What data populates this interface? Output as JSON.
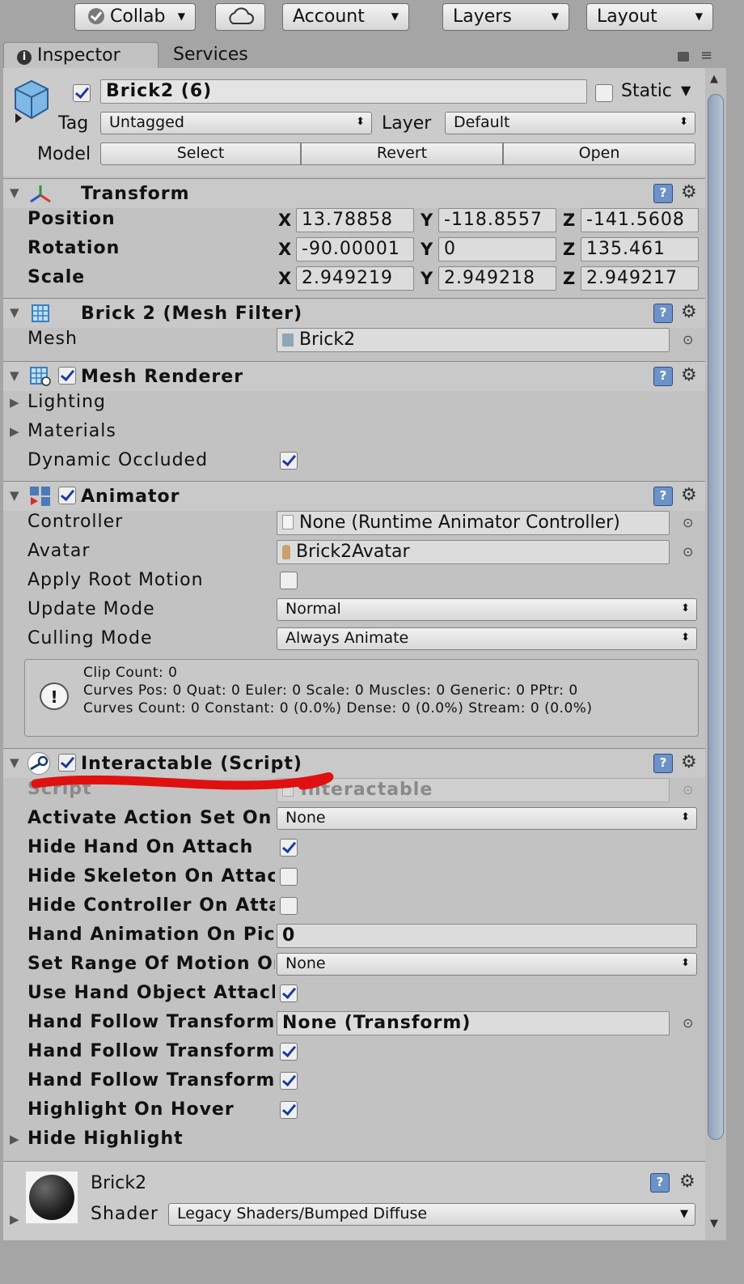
{
  "toolbar": {
    "collab": "Collab",
    "cloud_icon": "cloud-icon",
    "account": "Account",
    "layers": "Layers",
    "layout": "Layout"
  },
  "tabs": {
    "inspector": "Inspector",
    "services": "Services"
  },
  "object": {
    "name": "Brick2 (6)",
    "static_label": "Static",
    "tag_label": "Tag",
    "tag_value": "Untagged",
    "layer_label": "Layer",
    "layer_value": "Default",
    "model_label": "Model",
    "select": "Select",
    "revert": "Revert",
    "open": "Open"
  },
  "transform": {
    "title": "Transform",
    "position_label": "Position",
    "rotation_label": "Rotation",
    "scale_label": "Scale",
    "x": "X",
    "y": "Y",
    "z": "Z",
    "position": [
      "13.78858",
      "-118.8557",
      "-141.5608"
    ],
    "rotation": [
      "-90.00001",
      "0",
      "135.461"
    ],
    "scale": [
      "2.949219",
      "2.949218",
      "2.949217"
    ]
  },
  "mesh_filter": {
    "title": "Brick 2 (Mesh Filter)",
    "mesh_label": "Mesh",
    "mesh_value": "Brick2"
  },
  "mesh_renderer": {
    "title": "Mesh Renderer",
    "lighting": "Lighting",
    "materials": "Materials",
    "dynamic_occluded": "Dynamic Occluded"
  },
  "animator": {
    "title": "Animator",
    "controller_label": "Controller",
    "controller_value": "None (Runtime Animator Controller)",
    "avatar_label": "Avatar",
    "avatar_value": "Brick2Avatar",
    "apply_root_motion": "Apply Root Motion",
    "update_mode_label": "Update Mode",
    "update_mode_value": "Normal",
    "culling_mode_label": "Culling Mode",
    "culling_mode_value": "Always Animate",
    "info_line1": "Clip Count: 0",
    "info_line2": "Curves Pos: 0 Quat: 0 Euler: 0 Scale: 0 Muscles: 0 Generic: 0 PPtr: 0",
    "info_line3": "Curves Count: 0 Constant: 0 (0.0%) Dense: 0 (0.0%) Stream: 0 (0.0%)"
  },
  "interactable": {
    "title": "Interactable (Script)",
    "script_label": "Script",
    "script_value": "Interactable",
    "activate_action_set_label": "Activate Action Set On A",
    "activate_action_set_value": "None",
    "hide_hand_label": "Hide Hand On Attach",
    "hide_skeleton_label": "Hide Skeleton On Attach",
    "hide_controller_label": "Hide Controller On Attac",
    "hand_anim_label": "Hand Animation On Pick",
    "hand_anim_value": "0",
    "set_range_label": "Set Range Of Motion On",
    "set_range_value": "None",
    "use_hand_object_label": "Use Hand Object Attach",
    "hand_follow_1_label": "Hand Follow Transform",
    "hand_follow_1_value": "None (Transform)",
    "hand_follow_2_label": "Hand Follow Transform",
    "hand_follow_3_label": "Hand Follow Transform",
    "highlight_label": "Highlight On Hover",
    "hide_highlight_label": "Hide Highlight"
  },
  "material": {
    "name": "Brick2",
    "shader_label": "Shader",
    "shader_value": "Legacy Shaders/Bumped Diffuse"
  },
  "colors": {
    "annotation_stroke": "#e01010",
    "help_icon": "#6d92c8",
    "checkmark": "#1b3a9a"
  }
}
